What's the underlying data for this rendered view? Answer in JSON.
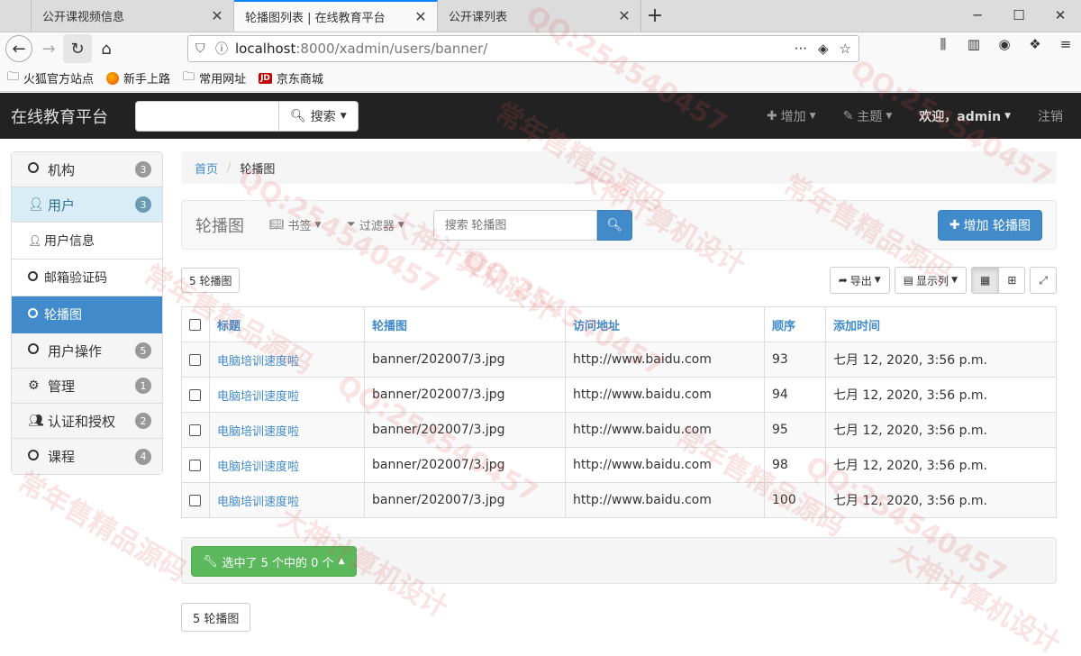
{
  "browser": {
    "tabs": [
      {
        "title": "公开课视频信息",
        "active": false
      },
      {
        "title": "轮播图列表 | 在线教育平台",
        "active": true
      },
      {
        "title": "公开课列表",
        "active": false
      }
    ],
    "url_host": "localhost",
    "url_path": ":8000/xadmin/users/banner/",
    "bookmarks": [
      "火狐官方站点",
      "新手上路",
      "常用网址",
      "京东商城"
    ],
    "jd_badge": "JD"
  },
  "app": {
    "brand": "在线教育平台",
    "search_button": "搜索",
    "menu": {
      "add": "增加",
      "theme": "主题",
      "welcome": "欢迎，admin",
      "logout": "注销"
    }
  },
  "sidebar": {
    "items": [
      {
        "label": "机构",
        "badge": "3"
      },
      {
        "label": "用户",
        "badge": "3"
      },
      {
        "label": "用户信息"
      },
      {
        "label": "邮箱验证码"
      },
      {
        "label": "轮播图"
      },
      {
        "label": "用户操作",
        "badge": "5"
      },
      {
        "label": "管理",
        "badge": "1"
      },
      {
        "label": "认证和授权",
        "badge": "2"
      },
      {
        "label": "课程",
        "badge": "4"
      }
    ]
  },
  "breadcrumb": {
    "home": "首页",
    "current": "轮播图"
  },
  "list": {
    "title": "轮播图",
    "bookmarks": "书签",
    "filters": "过滤器",
    "search_placeholder": "搜索 轮播图",
    "add_button": "增加 轮播图",
    "count_label": "5 轮播图",
    "export": "导出",
    "columns_toggle": "显示列",
    "headers": [
      "标题",
      "轮播图",
      "访问地址",
      "顺序",
      "添加时间"
    ],
    "rows": [
      {
        "title": "电脑培训速度啦",
        "image": "banner/202007/3.jpg",
        "url": "http://www.baidu.com",
        "index": "93",
        "added": "七月 12, 2020, 3:56 p.m."
      },
      {
        "title": "电脑培训速度啦",
        "image": "banner/202007/3.jpg",
        "url": "http://www.baidu.com",
        "index": "94",
        "added": "七月 12, 2020, 3:56 p.m."
      },
      {
        "title": "电脑培训速度啦",
        "image": "banner/202007/3.jpg",
        "url": "http://www.baidu.com",
        "index": "95",
        "added": "七月 12, 2020, 3:56 p.m."
      },
      {
        "title": "电脑培训速度啦",
        "image": "banner/202007/3.jpg",
        "url": "http://www.baidu.com",
        "index": "98",
        "added": "七月 12, 2020, 3:56 p.m."
      },
      {
        "title": "电脑培训速度啦",
        "image": "banner/202007/3.jpg",
        "url": "http://www.baidu.com",
        "index": "100",
        "added": "七月 12, 2020, 3:56 p.m."
      }
    ],
    "selection": "选中了 5 个中的 0 个"
  },
  "watermark": [
    "常年售精品源码",
    "QQ:254540457",
    "大神计算机设计"
  ],
  "colors": {
    "primary": "#428bca",
    "success": "#5cb85c",
    "navbar": "#222222",
    "sidebar_open": "#d9edf7"
  }
}
